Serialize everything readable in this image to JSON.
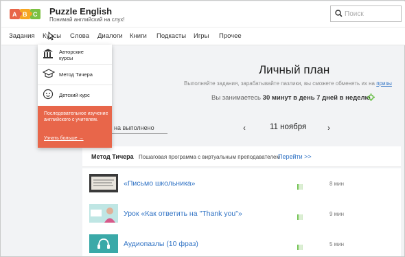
{
  "header": {
    "brand": "Puzzle English",
    "tagline": "Понимай английский на слух!",
    "logo_letters": [
      "A",
      "B",
      "C"
    ],
    "logo_colors": [
      "#e8664a",
      "#f6a623",
      "#7cc043"
    ]
  },
  "search": {
    "placeholder": "Поиск"
  },
  "nav": {
    "items": [
      {
        "label": "Задания"
      },
      {
        "label": "Курсы"
      },
      {
        "label": "Слова"
      },
      {
        "label": "Диалоги"
      },
      {
        "label": "Книги"
      },
      {
        "label": "Подкасты"
      },
      {
        "label": "Игры"
      },
      {
        "label": "Прочее"
      }
    ]
  },
  "dropdown": {
    "items": [
      {
        "label": "Авторские курсы",
        "icon": "museum-icon"
      },
      {
        "label": "Метод Тичера",
        "icon": "graduation-cap-icon"
      },
      {
        "label": "Детский курс",
        "icon": "child-face-icon"
      }
    ],
    "promo": {
      "text": "Последовательное изучение английского с учителем.",
      "link": "Узнать больше →",
      "color": "#e8664a"
    }
  },
  "plan": {
    "title": "Личный план",
    "desc_prefix": "Выполняйте задания, зарабатывайте пазлики, вы сможете обменять их на",
    "desc_link": "призы",
    "schedule_prefix": "Вы занимаетесь",
    "schedule_bold": "30 минут в день 7 дней в неделю",
    "done_label": "на выполнено",
    "date": "11 ноября",
    "prev_arrow": "‹",
    "next_arrow": "›"
  },
  "method": {
    "title": "Метод Тичера",
    "desc": "Пошаговая программа с виртуальным преподавателем",
    "goto": "Перейти >>"
  },
  "lessons": [
    {
      "title": "«Письмо школьника»",
      "time": "8 мин",
      "level": 1,
      "thumb": "letter-thumbnail"
    },
    {
      "title": "Урок «Как ответить на \"Thank you\"»",
      "time": "9 мин",
      "level": 1,
      "thumb": "teacher-thumbnail"
    },
    {
      "title": "Аудиопазлы (10 фраз)",
      "time": "5 мин",
      "level": 1,
      "thumb": "headphones-thumbnail"
    }
  ],
  "colors": {
    "accent_link": "#2f72c4",
    "promo": "#e8664a",
    "difficulty_bar": "#6cc04a",
    "headphones_tile": "#3aa9a8"
  }
}
